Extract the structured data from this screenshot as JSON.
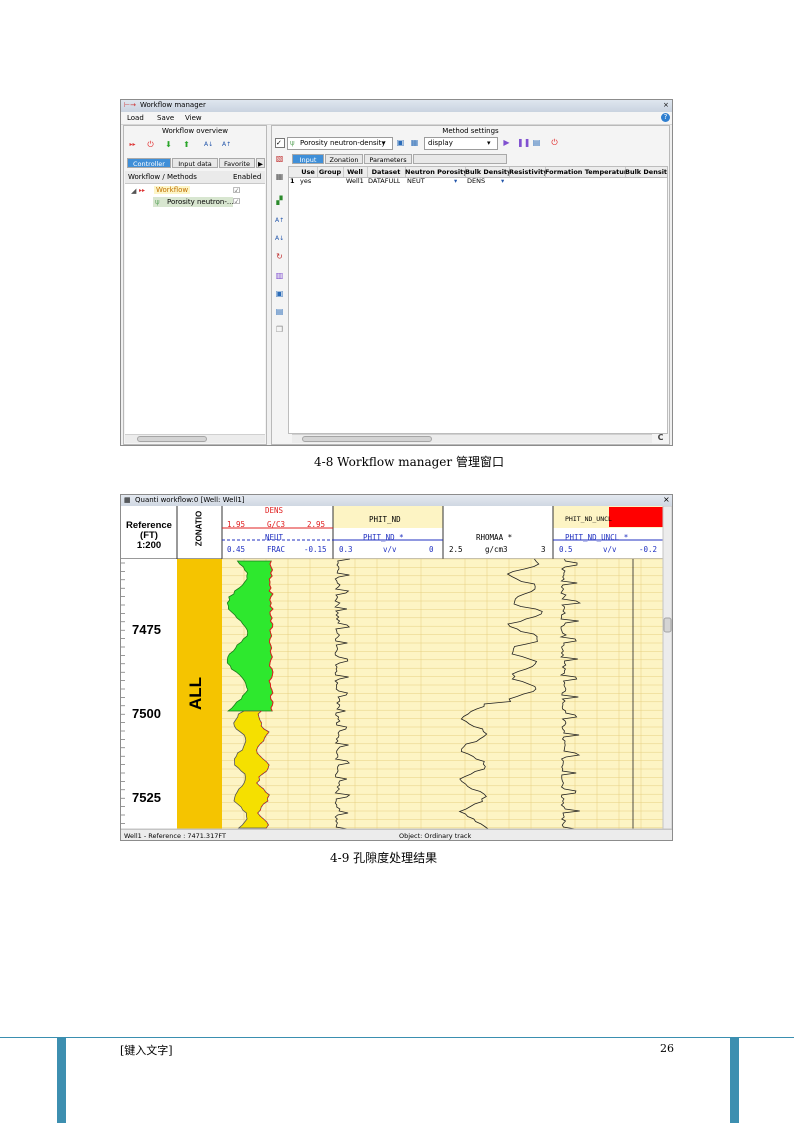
{
  "figure1": {
    "window_title": "Workflow manager",
    "close_glyph": "×",
    "help_glyph": "?",
    "menu": [
      "Load",
      "Save",
      "View"
    ],
    "overview_label": "Workflow overview",
    "left_tabs": [
      "Controller",
      "Input data",
      "Favorite"
    ],
    "tree_header": [
      "Workflow / Methods",
      "Enabled"
    ],
    "tree_items": [
      {
        "label": "Workflow",
        "checked": "☑"
      },
      {
        "label": "Porosity neutron-...",
        "checked": "☑"
      }
    ],
    "method_settings_label": "Method settings",
    "method_combo": "Porosity neutron-density",
    "display_combo": "display",
    "right_tabs": [
      "Input",
      "Zonation",
      "Parameters"
    ],
    "grid_headers": [
      "Use",
      "Group",
      "Well",
      "Dataset",
      "Neutron Porosity",
      "Bulk Density",
      "Resistivity",
      "Formation Temperature",
      "Bulk Densit"
    ],
    "grid_row": {
      "index": "1",
      "use": "yes",
      "group": "",
      "well": "Well1",
      "dataset": "DATAFULL",
      "neutron": "NEUT",
      "bulk": "DENS"
    },
    "caption": "4-8 Workflow manager 管理窗口",
    "icons": [
      "run-icon",
      "stop-icon",
      "move-down-icon",
      "move-up-icon",
      "sort-az-icon",
      "sort-za-icon",
      "play-icon",
      "pause-icon",
      "step-icon"
    ]
  },
  "figure2": {
    "window_title": "Quanti workflow:0 [Well: Well1]",
    "reference_label": "Reference",
    "reference_unit": "(FT)",
    "reference_scale": "1:200",
    "zonation_label": "ZONATIO",
    "zone_name": "ALL",
    "track1": {
      "dens_name": "DENS",
      "dens_min": "1.95",
      "dens_unit": "G/C3",
      "dens_max": "2.95",
      "neut_name": "NEUT",
      "neut_min": "0.45",
      "neut_unit": "FRAC",
      "neut_max": "-0.15"
    },
    "track2": {
      "title": "PHIT_ND",
      "curve": "PHIT_ND *",
      "min": "0.3",
      "unit": "v/v",
      "max": "0"
    },
    "track3": {
      "title": "",
      "curve": "RHOMAA *",
      "min": "2.5",
      "unit": "g/cm3",
      "max": "3"
    },
    "track4": {
      "title": "PHIT_ND_UNCL",
      "curve": "PHIT_ND_UNCL *",
      "min": "0.5",
      "unit": "v/v",
      "max": "-0.2"
    },
    "depths": [
      "7475",
      "7500",
      "7525"
    ],
    "status_left": "Well1 - Reference : 7471.317FT",
    "status_right": "Object: Ordinary track",
    "caption": "4-9 孔隙度处理结果",
    "colors": {
      "zone": "#f5c400",
      "fill_green": "#2ee82e",
      "fill_yellow": "#f5e000",
      "track_bg": "#fdf4c4",
      "highlight_red": "#ff0000"
    }
  },
  "footer": {
    "left_text": "[键入文字]",
    "page_number": "26",
    "bar_color": "#3d8fb0"
  }
}
